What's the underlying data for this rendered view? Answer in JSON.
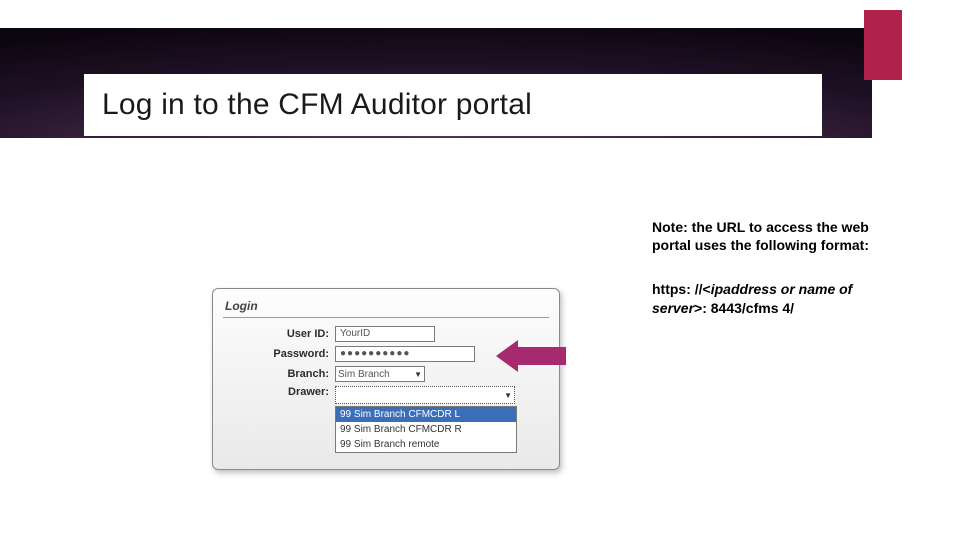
{
  "slide": {
    "title": "Log in to the CFM Auditor portal"
  },
  "login": {
    "panel_title": "Login",
    "user_label": "User ID:",
    "user_value": "YourID",
    "password_label": "Password:",
    "password_value": "●●●●●●●●●●",
    "branch_label": "Branch:",
    "branch_value": "Sim Branch",
    "drawer_label": "Drawer:",
    "drawer_value": "",
    "drawer_options": {
      "o0": "99 Sim Branch CFMCDR L",
      "o1": "99 Sim Branch CFMCDR R",
      "o2": "99 Sim Branch remote"
    }
  },
  "note": {
    "line1": "Note: the URL to access the web portal uses the following format:",
    "line2a": "https: //<",
    "line2b": "ipaddress or name of server",
    "line2c": ">: 8443/cfms 4/"
  }
}
